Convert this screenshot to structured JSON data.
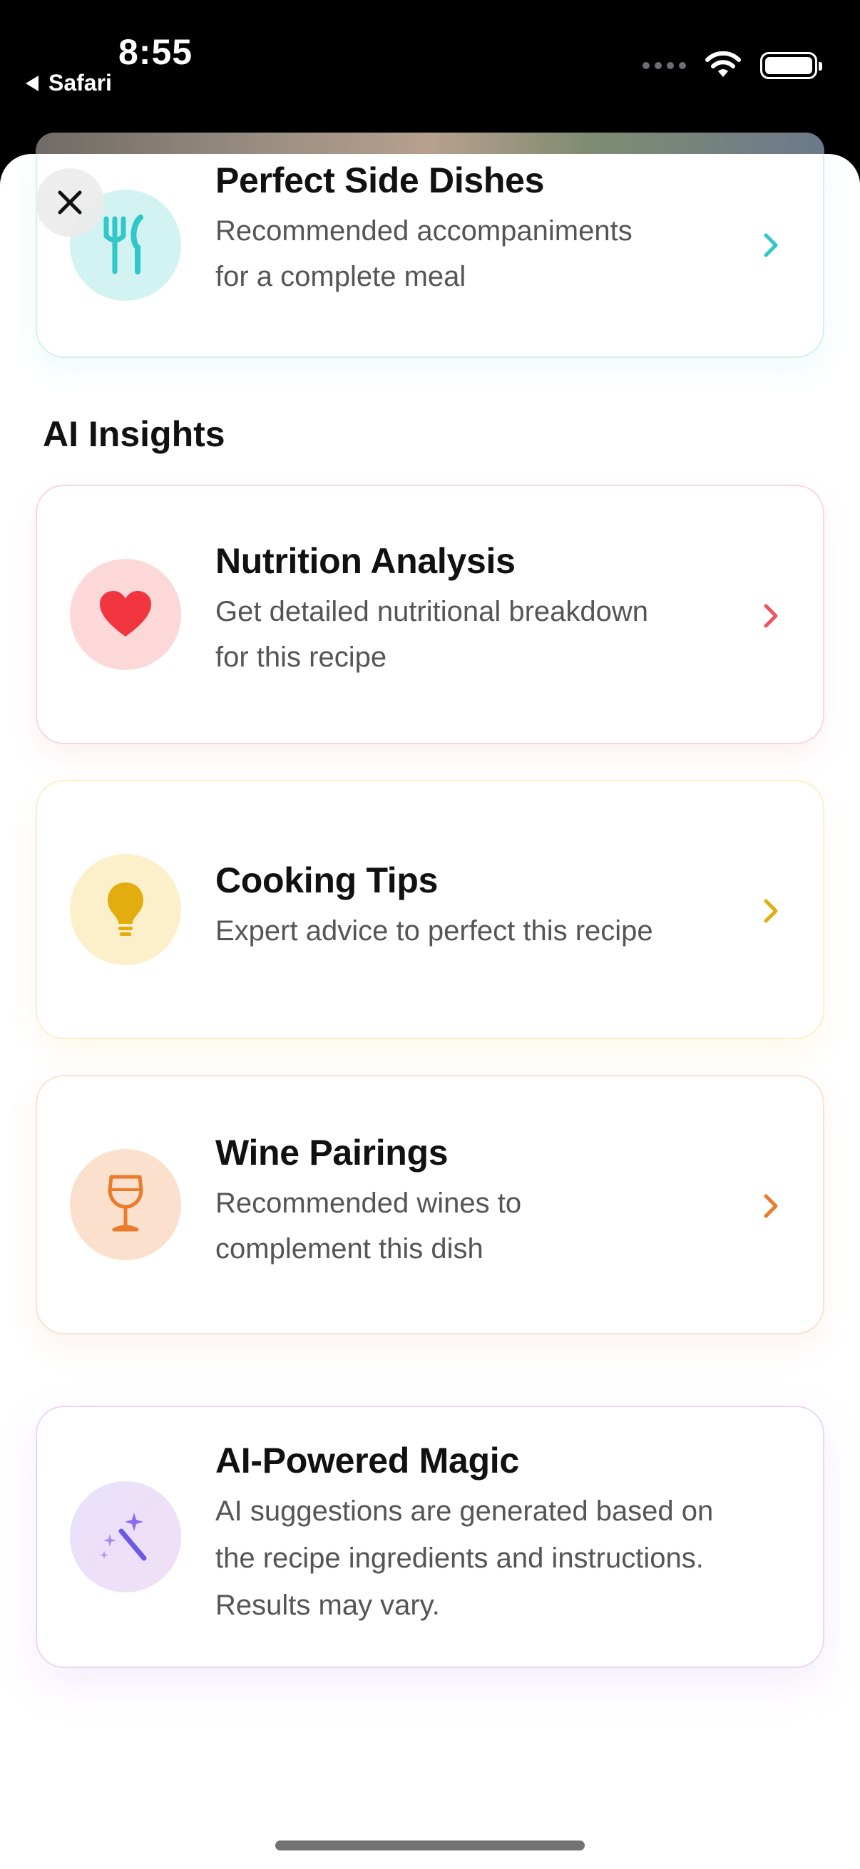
{
  "status_bar": {
    "time": "8:55",
    "back_label": "Safari"
  },
  "side_dishes_card": {
    "title": "Perfect Side Dishes",
    "desc_line1": "Recommended accompaniments",
    "desc_line2": "for a complete meal",
    "icon": "fork-knife-icon",
    "accent": "#2fc7c7"
  },
  "section": {
    "title": "AI Insights"
  },
  "insights": [
    {
      "title": "Nutrition Analysis",
      "desc_line1": "Get detailed nutritional breakdown",
      "desc_line2": "for this recipe",
      "icon": "heart-icon",
      "accent": "#f0555e"
    },
    {
      "title": "Cooking Tips",
      "desc_line1": "Expert advice to perfect this recipe",
      "icon": "lightbulb-icon",
      "accent": "#e3ad0f"
    },
    {
      "title": "Wine Pairings",
      "desc_line1": "Recommended wines to",
      "desc_line2": "complement this dish",
      "icon": "wine-glass-icon",
      "accent": "#ea7b2a"
    }
  ],
  "ai_card": {
    "title": "AI-Powered Magic",
    "desc_line1": "AI suggestions are generated based on",
    "desc_line2": "the recipe ingredients and instructions.",
    "desc_line3": "Results may vary.",
    "icon": "magic-wand-icon",
    "accent": "#8a6cf0"
  }
}
